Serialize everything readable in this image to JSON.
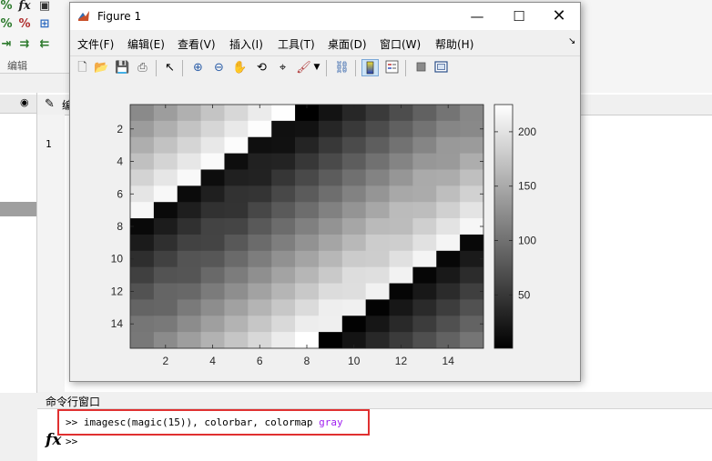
{
  "toolstrip": {
    "section_label": "编辑",
    "icons": [
      "percent-icon",
      "fx-icon",
      "insert-icon"
    ]
  },
  "editor": {
    "tab_label": "编",
    "line_number": "1"
  },
  "figure": {
    "title": "Figure 1",
    "menus": [
      "文件(F)",
      "编辑(E)",
      "查看(V)",
      "插入(I)",
      "工具(T)",
      "桌面(D)",
      "窗口(W)",
      "帮助(H)"
    ],
    "toolbar_tools": [
      "new-figure-icon",
      "open-file-icon",
      "save-icon",
      "print-icon",
      "pointer-icon",
      "zoom-in-icon",
      "zoom-out-icon",
      "pan-hand-icon",
      "rotate-3d-icon",
      "data-cursor-icon",
      "brush-icon",
      "brush-dropdown-icon",
      "link-plot-icon",
      "colorbar-toggle-icon",
      "legend-toggle-icon",
      "hide-plot-tools-icon",
      "show-plot-tools-icon"
    ]
  },
  "command_window": {
    "title": "命令行窗口",
    "command_prefix": ">> imagesc(magic(15)), colorbar, colormap ",
    "command_arg": "gray",
    "prompt": ">>"
  },
  "chart_data": {
    "type": "heatmap",
    "title": "",
    "xlabel": "",
    "ylabel": "",
    "colormap": "gray",
    "x_ticks": [
      2,
      4,
      6,
      8,
      10,
      12,
      14
    ],
    "y_ticks": [
      2,
      4,
      6,
      8,
      10,
      12,
      14
    ],
    "x_lim": [
      0.5,
      15.5
    ],
    "y_lim": [
      0.5,
      15.5
    ],
    "y_direction": "reverse",
    "color_range": [
      1,
      225
    ],
    "colorbar_ticks": [
      50,
      100,
      150,
      200
    ],
    "matrix": [
      [
        122,
        139,
        156,
        173,
        190,
        207,
        224,
        1,
        18,
        35,
        52,
        69,
        86,
        103,
        120
      ],
      [
        138,
        155,
        172,
        189,
        206,
        223,
        15,
        17,
        34,
        51,
        68,
        85,
        102,
        119,
        121
      ],
      [
        154,
        171,
        188,
        205,
        222,
        14,
        16,
        33,
        50,
        67,
        84,
        101,
        118,
        135,
        137
      ],
      [
        170,
        187,
        204,
        221,
        13,
        30,
        32,
        49,
        66,
        83,
        100,
        117,
        134,
        136,
        153
      ],
      [
        186,
        203,
        220,
        12,
        29,
        31,
        48,
        65,
        82,
        99,
        116,
        133,
        150,
        152,
        169
      ],
      [
        202,
        219,
        11,
        28,
        45,
        47,
        64,
        81,
        98,
        115,
        132,
        149,
        151,
        168,
        185
      ],
      [
        218,
        10,
        27,
        44,
        46,
        63,
        80,
        97,
        114,
        131,
        148,
        165,
        167,
        184,
        201
      ],
      [
        9,
        26,
        43,
        60,
        62,
        79,
        96,
        113,
        130,
        147,
        164,
        166,
        183,
        200,
        217
      ],
      [
        25,
        42,
        59,
        61,
        78,
        95,
        112,
        129,
        146,
        163,
        180,
        182,
        199,
        216,
        8
      ],
      [
        41,
        58,
        75,
        77,
        94,
        111,
        128,
        145,
        162,
        179,
        181,
        198,
        215,
        7,
        24
      ],
      [
        57,
        74,
        76,
        93,
        110,
        127,
        144,
        161,
        178,
        195,
        197,
        214,
        6,
        23,
        40
      ],
      [
        73,
        90,
        92,
        109,
        126,
        143,
        160,
        177,
        194,
        196,
        213,
        5,
        22,
        39,
        56
      ],
      [
        89,
        91,
        108,
        125,
        142,
        159,
        176,
        193,
        210,
        212,
        4,
        21,
        38,
        55,
        72
      ],
      [
        105,
        107,
        124,
        141,
        158,
        175,
        192,
        209,
        211,
        3,
        20,
        37,
        54,
        71,
        88
      ],
      [
        106,
        123,
        140,
        157,
        174,
        191,
        208,
        225,
        2,
        19,
        36,
        53,
        70,
        87,
        104
      ]
    ]
  }
}
